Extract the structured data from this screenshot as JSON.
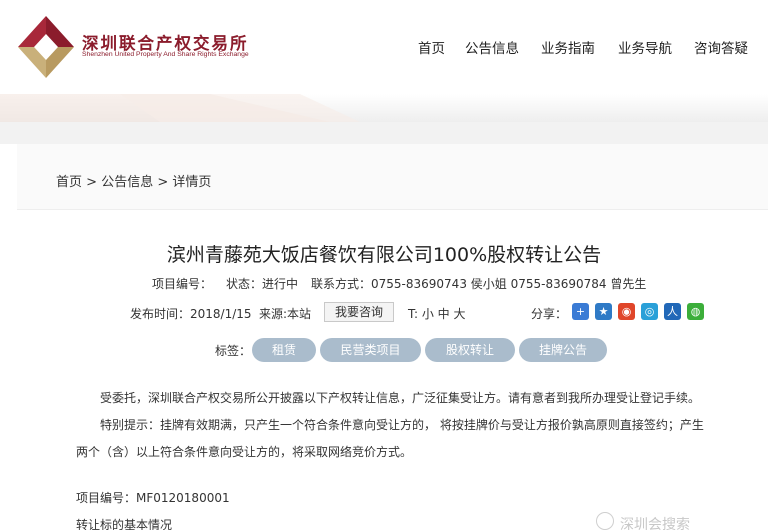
{
  "header": {
    "logo_cn": "深圳联合产权交易所",
    "logo_en": "Shenzhen United Property And Share Rights Exchange",
    "nav": [
      "首页",
      "公告信息",
      "业务指南",
      "业务导航",
      "咨询答疑"
    ]
  },
  "breadcrumb": {
    "home": "首页",
    "sep": ">",
    "section": "公告信息",
    "current": "详情页"
  },
  "article": {
    "title": "滨州青藤苑大饭店餐饮有限公司100%股权转让公告",
    "project_no_label": "项目编号：",
    "status": "状态：进行中",
    "contact": "联系方式：0755-83690743 侯小姐 0755-83690784 曾先生",
    "publish_time": "发布时间：2018/1/15",
    "source": "来源:本站",
    "ask_button": "我要咨询",
    "font_sizes": "T: 小 中 大",
    "share_label": "分享："
  },
  "share_icons": [
    {
      "name": "plus-share-icon",
      "glyph": "+",
      "color": "#3a7bd5"
    },
    {
      "name": "star-share-icon",
      "glyph": "★",
      "color": "#2f7ac6"
    },
    {
      "name": "weibo-share-icon",
      "glyph": "◉",
      "color": "#e0462a"
    },
    {
      "name": "tencent-weibo-share-icon",
      "glyph": "◎",
      "color": "#2aa0d8"
    },
    {
      "name": "renren-share-icon",
      "glyph": "人",
      "color": "#2168b8"
    },
    {
      "name": "wechat-share-icon",
      "glyph": "◍",
      "color": "#3cae3a"
    }
  ],
  "tags": {
    "label": "标签：",
    "items": [
      "租赁",
      "民营类项目",
      "股权转让",
      "挂牌公告"
    ]
  },
  "body": {
    "p1": "受委托，深圳联合产权交易所公开披露以下产权转让信息，广泛征集受让方。请有意者到我所办理受让登记手续。",
    "p2a": "特别提示：挂牌有效期满，只产生一个符合条件意向受让方的， 将按挂牌价与受让方报价孰高原则直接签约；产生",
    "p2b": "两个（含）以上符合条件意向受让方的，将采取网络竞价方式。",
    "project_no": "项目编号：MF0120180001",
    "section_basic": "转让标的基本情况"
  },
  "watermark": "深圳会搜索"
}
